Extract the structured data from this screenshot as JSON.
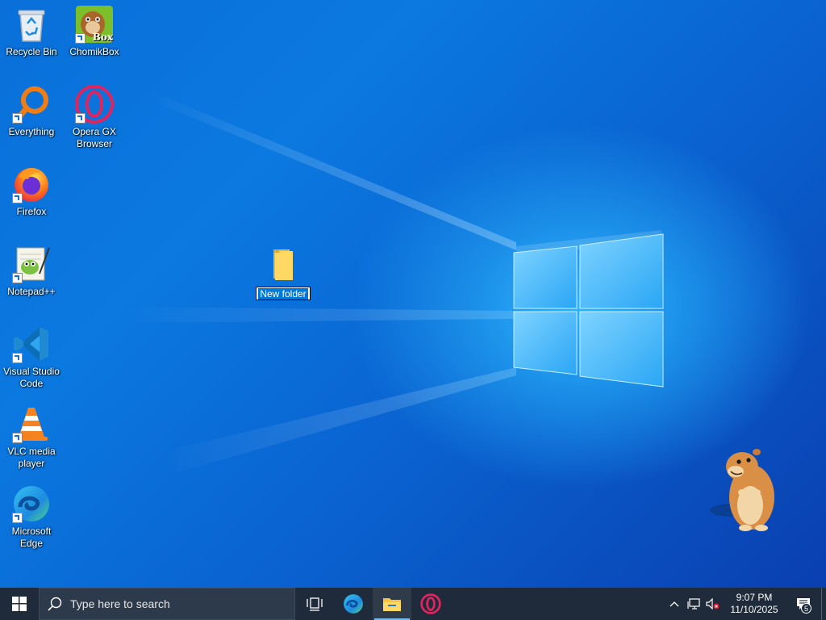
{
  "desktop": {
    "icons": [
      {
        "label": "Recycle Bin",
        "icon": "recycle-bin-icon"
      },
      {
        "label": "ChomikBox",
        "icon": "chomikbox-icon",
        "badge_text": "Box"
      },
      {
        "label": "Everything",
        "icon": "everything-search-icon"
      },
      {
        "label": "Opera GX\nBrowser",
        "icon": "opera-gx-icon"
      },
      {
        "label": "Firefox",
        "icon": "firefox-icon"
      },
      {
        "label": "Notepad++",
        "icon": "notepad-plus-plus-icon"
      },
      {
        "label": "Visual Studio\nCode",
        "icon": "vscode-icon"
      },
      {
        "label": "VLC media\nplayer",
        "icon": "vlc-icon"
      },
      {
        "label": "Microsoft\nEdge",
        "icon": "edge-icon"
      }
    ],
    "new_folder": {
      "label": "New folder",
      "icon": "folder-icon"
    }
  },
  "taskbar": {
    "search_placeholder": "Type here to search",
    "apps": [
      {
        "name": "task-view",
        "icon": "task-view-icon"
      },
      {
        "name": "edge",
        "icon": "edge-icon"
      },
      {
        "name": "file-explorer",
        "icon": "file-explorer-icon",
        "active": true
      },
      {
        "name": "opera",
        "icon": "opera-icon"
      }
    ],
    "clock": {
      "time": "9:07 PM",
      "date": "11/10/2025"
    },
    "notification_count": "5"
  },
  "colors": {
    "taskbar_bg": "#1f2b3b",
    "desktop_blue": "#0a6fd9",
    "selection": "#0078d7"
  }
}
